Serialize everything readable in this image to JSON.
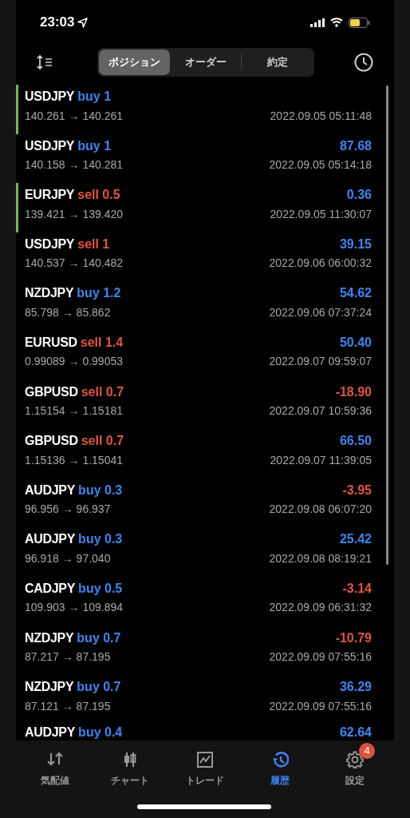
{
  "status_bar": {
    "time": "23:03"
  },
  "segments": [
    {
      "label": "ポジション",
      "selected": true
    },
    {
      "label": "オーダー",
      "selected": false
    },
    {
      "label": "約定",
      "selected": false
    }
  ],
  "rows": [
    {
      "symbol": "USDJPY",
      "kind": "buy",
      "volume": "buy 1",
      "prices": "140.261 → 140.261",
      "time": "2022.09.05 05:11:48",
      "marker": true
    },
    {
      "symbol": "USDJPY",
      "kind": "buy",
      "volume": "buy 1",
      "profit": "87.68",
      "loss": false,
      "prices": "140.158 → 140.281",
      "time": "2022.09.05 05:14:18",
      "marker": false
    },
    {
      "symbol": "EURJPY",
      "kind": "sell",
      "volume": "sell 0.5",
      "profit": "0.36",
      "loss": false,
      "prices": "139.421 → 139.420",
      "time": "2022.09.05 11:30:07",
      "marker": true
    },
    {
      "symbol": "USDJPY",
      "kind": "sell",
      "volume": "sell 1",
      "profit": "39.15",
      "loss": false,
      "prices": "140.537 → 140.482",
      "time": "2022.09.06 06:00:32",
      "marker": false
    },
    {
      "symbol": "NZDJPY",
      "kind": "buy",
      "volume": "buy 1.2",
      "profit": "54.62",
      "loss": false,
      "prices": "85.798 → 85.862",
      "time": "2022.09.06 07:37:24",
      "marker": false
    },
    {
      "symbol": "EURUSD",
      "kind": "sell",
      "volume": "sell 1.4",
      "profit": "50.40",
      "loss": false,
      "prices": "0.99089 → 0.99053",
      "time": "2022.09.07 09:59:07",
      "marker": false
    },
    {
      "symbol": "GBPUSD",
      "kind": "sell",
      "volume": "sell 0.7",
      "profit": "-18.90",
      "loss": true,
      "prices": "1.15154 → 1.15181",
      "time": "2022.09.07 10:59:36",
      "marker": false
    },
    {
      "symbol": "GBPUSD",
      "kind": "sell",
      "volume": "sell 0.7",
      "profit": "66.50",
      "loss": false,
      "prices": "1.15136 → 1.15041",
      "time": "2022.09.07 11:39:05",
      "marker": false
    },
    {
      "symbol": "AUDJPY",
      "kind": "buy",
      "volume": "buy 0.3",
      "profit": "-3.95",
      "loss": true,
      "prices": "96.956 → 96.937",
      "time": "2022.09.08 06:07:20",
      "marker": false
    },
    {
      "symbol": "AUDJPY",
      "kind": "buy",
      "volume": "buy 0.3",
      "profit": "25.42",
      "loss": false,
      "prices": "96.918 → 97.040",
      "time": "2022.09.08 08:19:21",
      "marker": false
    },
    {
      "symbol": "CADJPY",
      "kind": "buy",
      "volume": "buy 0.5",
      "profit": "-3.14",
      "loss": true,
      "prices": "109.903 → 109.894",
      "time": "2022.09.09 06:31:32",
      "marker": false
    },
    {
      "symbol": "NZDJPY",
      "kind": "buy",
      "volume": "buy 0.7",
      "profit": "-10.79",
      "loss": true,
      "prices": "87.217 → 87.195",
      "time": "2022.09.09 07:55:16",
      "marker": false
    },
    {
      "symbol": "NZDJPY",
      "kind": "buy",
      "volume": "buy 0.7",
      "profit": "36.29",
      "loss": false,
      "prices": "87.121 → 87.195",
      "time": "2022.09.09 07:55:16",
      "marker": false
    },
    {
      "symbol": "AUDJPY",
      "kind": "buy",
      "volume": "buy 0.4",
      "profit": "62.64",
      "loss": false,
      "marker": false
    }
  ],
  "tab_bar": [
    {
      "kind": "quotes",
      "label": "気配値",
      "selected": false
    },
    {
      "kind": "chart",
      "label": "チャート",
      "selected": false
    },
    {
      "kind": "trade",
      "label": "トレード",
      "selected": false
    },
    {
      "kind": "history",
      "label": "履歴",
      "selected": true
    },
    {
      "kind": "settings",
      "label": "設定",
      "selected": false,
      "badge": "4"
    }
  ]
}
